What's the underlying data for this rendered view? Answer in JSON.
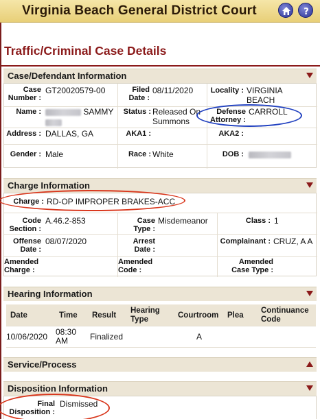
{
  "header": {
    "title": "Virginia Beach General District Court",
    "home_icon": "home-icon",
    "help_icon": "help-icon"
  },
  "page": {
    "title": "Traffic/Criminal Case Details"
  },
  "case_defendant": {
    "section_label": "Case/Defendant Information",
    "case_number_label": "Case Number :",
    "case_number": "GT20020579-00",
    "filed_date_label": "Filed Date :",
    "filed_date": "08/11/2020",
    "locality_label": "Locality :",
    "locality": "VIRGINIA BEACH",
    "name_label": "Name :",
    "name_first": "SAMMY",
    "status_label": "Status :",
    "status": "Released On Summons",
    "defense_attorney_label": "Defense Attorney :",
    "defense_attorney": "CARROLL",
    "address_label": "Address :",
    "address": "DALLAS, GA",
    "aka1_label": "AKA1 :",
    "aka2_label": "AKA2 :",
    "gender_label": "Gender :",
    "gender": "Male",
    "race_label": "Race :",
    "race": "White",
    "dob_label": "DOB :"
  },
  "charge": {
    "section_label": "Charge Information",
    "charge_label": "Charge :",
    "charge": "RD-OP IMPROPER BRAKES-ACC",
    "code_section_label": "Code Section :",
    "code_section": "A.46.2-853",
    "case_type_label": "Case Type :",
    "case_type": "Misdemeanor",
    "class_label": "Class :",
    "class": "1",
    "offense_date_label": "Offense Date :",
    "offense_date": "08/07/2020",
    "arrest_date_label": "Arrest Date :",
    "complainant_label": "Complainant :",
    "complainant": "CRUZ, A A",
    "amended_charge_label": "Amended Charge :",
    "amended_code_label": "Amended Code :",
    "amended_case_type_label": "Amended Case Type :"
  },
  "hearing": {
    "section_label": "Hearing Information",
    "columns": [
      "Date",
      "Time",
      "Result",
      "Hearing Type",
      "Courtroom",
      "Plea",
      "Continuance Code"
    ],
    "rows": [
      {
        "date": "10/06/2020",
        "time": "08:30 AM",
        "result": "Finalized",
        "hearing_type": "",
        "courtroom": "A",
        "plea": "",
        "continuance_code": ""
      }
    ]
  },
  "service": {
    "section_label": "Service/Process"
  },
  "disposition": {
    "section_label": "Disposition Information",
    "final_disposition_label": "Final Disposition :",
    "final_disposition": "Dismissed"
  },
  "colors": {
    "accent": "#8b1a1a",
    "header_bg": "#ecd48a",
    "section_bg": "#ece5d5",
    "annotation_red": "#d9381e",
    "annotation_blue": "#1f3fbf"
  }
}
